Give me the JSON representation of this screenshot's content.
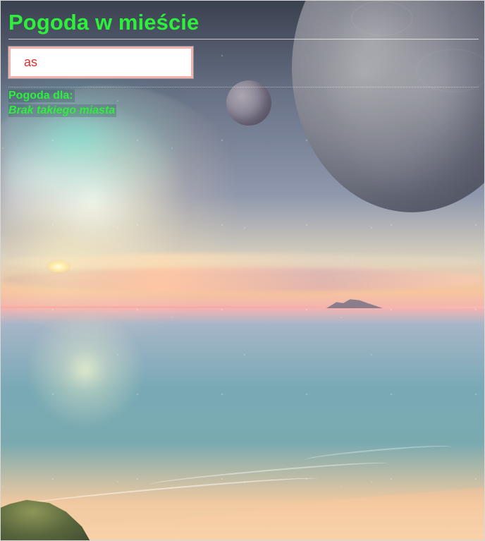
{
  "page": {
    "title": "Pogoda w mieście"
  },
  "search": {
    "value": "as",
    "placeholder": ""
  },
  "results": {
    "label": "Pogoda dla:",
    "message": "Brak takiego miasta"
  },
  "colors": {
    "accent_text": "#2df03a",
    "input_border": "#f5b2aa",
    "input_text": "#e22f2f"
  }
}
